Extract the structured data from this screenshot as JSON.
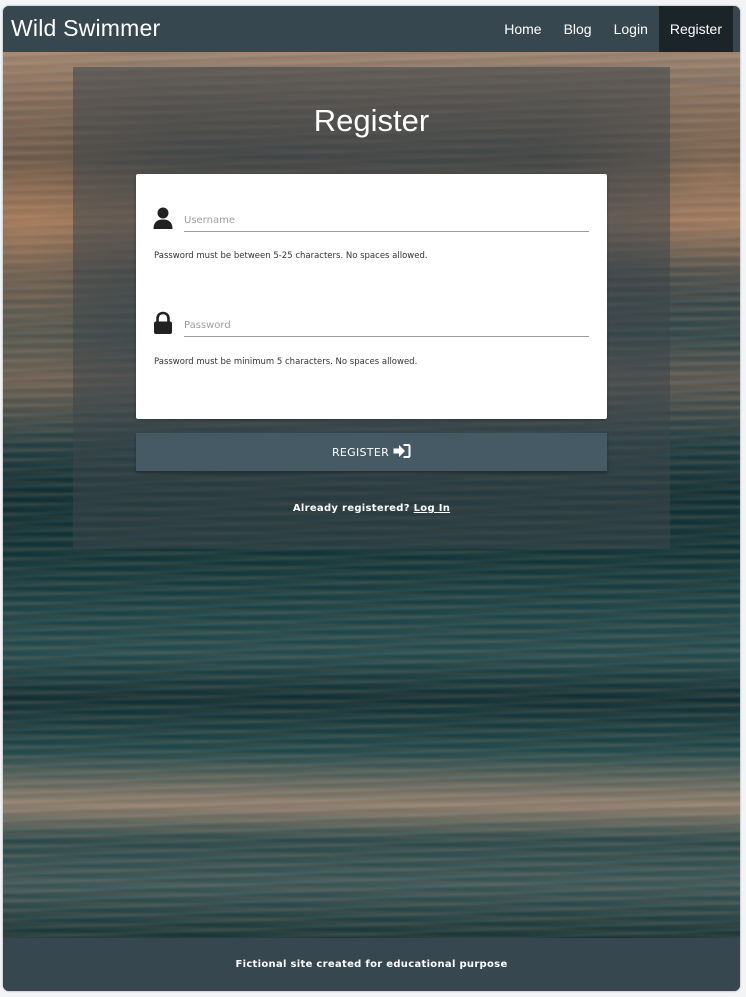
{
  "navbar": {
    "brand": "Wild Swimmer",
    "items": [
      {
        "label": "Home",
        "active": false
      },
      {
        "label": "Blog",
        "active": false
      },
      {
        "label": "Login",
        "active": false
      },
      {
        "label": "Register",
        "active": true
      }
    ]
  },
  "main": {
    "title": "Register",
    "username": {
      "icon": "person-icon",
      "placeholder": "Username",
      "value": "",
      "helper": "Password must be between 5-25 characters. No spaces allowed."
    },
    "password": {
      "icon": "lock-icon",
      "placeholder": "Password",
      "value": "",
      "helper": "Password must be minimum 5 characters. No spaces allowed."
    },
    "submit": {
      "label": "REGISTER",
      "icon": "sign-in-icon"
    },
    "already_text": "Already registered?",
    "login_link": "Log In"
  },
  "footer": {
    "text": "Fictional site created for educational purpose"
  },
  "colors": {
    "navbar": "#37474f",
    "active_nav": "#1b2428",
    "button": "#455a64",
    "card": "#ffffff"
  }
}
